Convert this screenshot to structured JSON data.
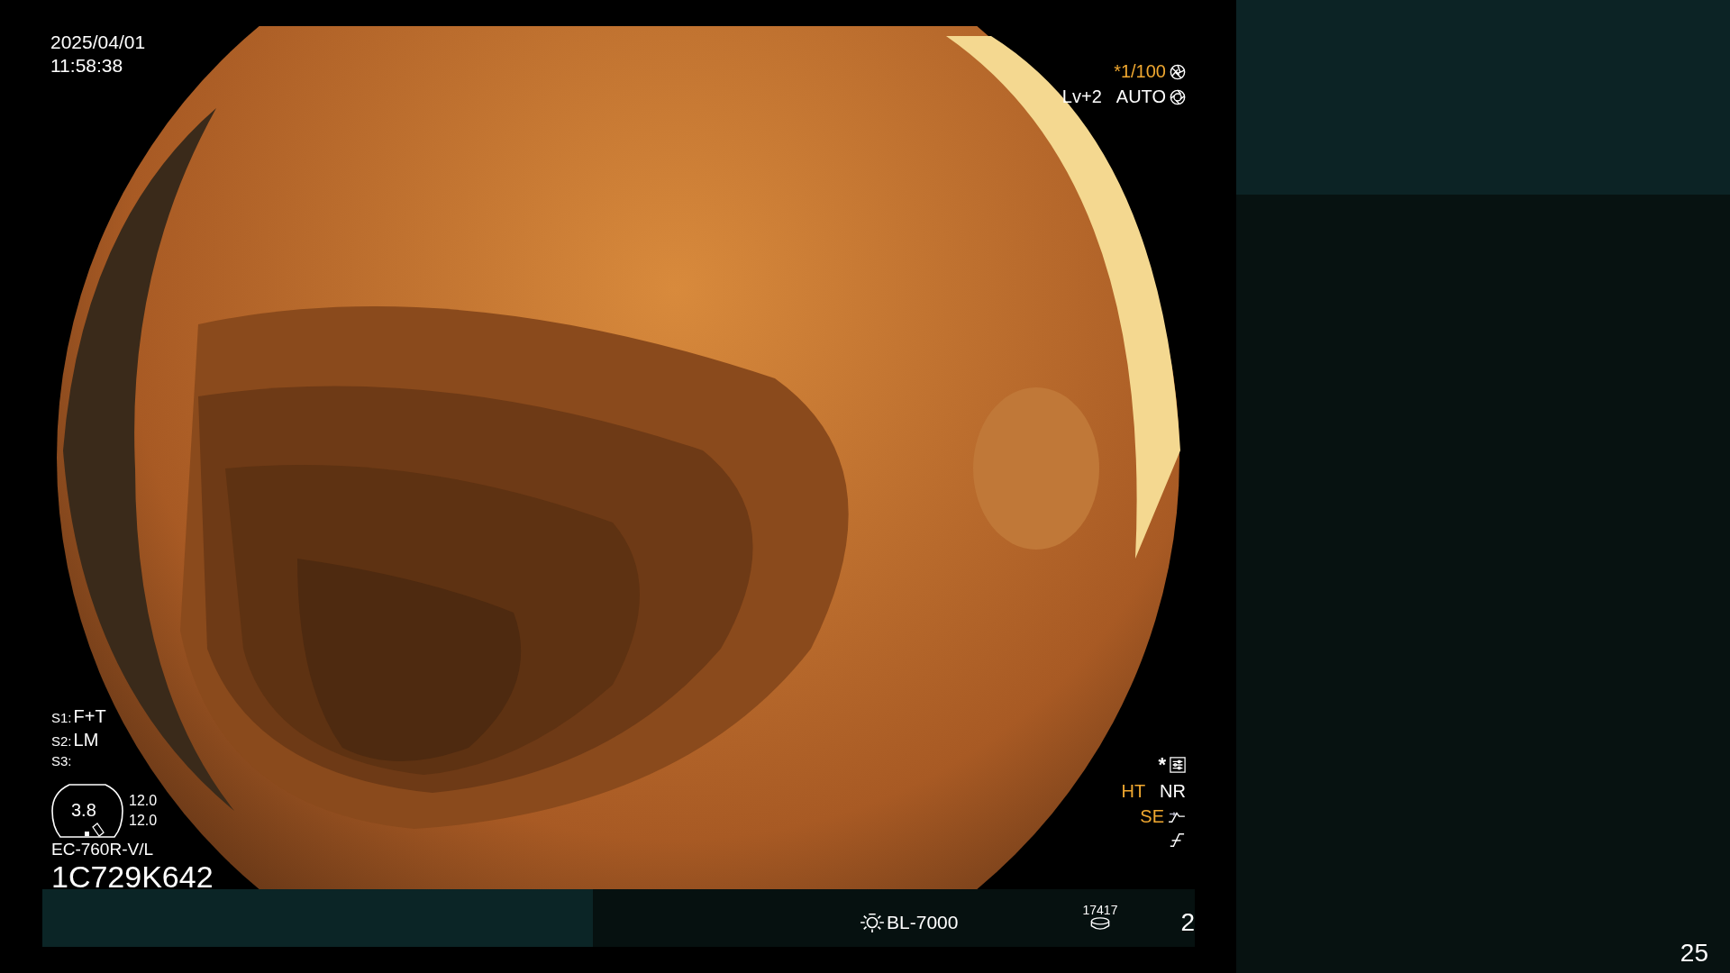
{
  "datetime": {
    "date": "2025/04/01",
    "time": "11:58:38"
  },
  "exposure": {
    "shutter": "*1/100",
    "level": "Lv+2",
    "mode": "AUTO"
  },
  "scope_settings": [
    {
      "key": "S1:",
      "value": "F+T"
    },
    {
      "key": "S2:",
      "value": "LM"
    },
    {
      "key": "S3:"
    }
  ],
  "gauge": {
    "value": "3.8",
    "readings": [
      "12.0",
      "12.0"
    ]
  },
  "scope_model": "EC-760R-V/L",
  "serial": "1C729K642",
  "indicators": {
    "asterisk": "*",
    "tags": [
      {
        "text": "HT",
        "color": "#f0a830"
      },
      {
        "text": "NR",
        "color": "#ffffff"
      }
    ],
    "se": {
      "text": "SE",
      "color": "#f0a830"
    }
  },
  "bottom_bar": {
    "light_source": "BL-7000",
    "counter": "17417",
    "number": "2"
  },
  "page_number": "25"
}
